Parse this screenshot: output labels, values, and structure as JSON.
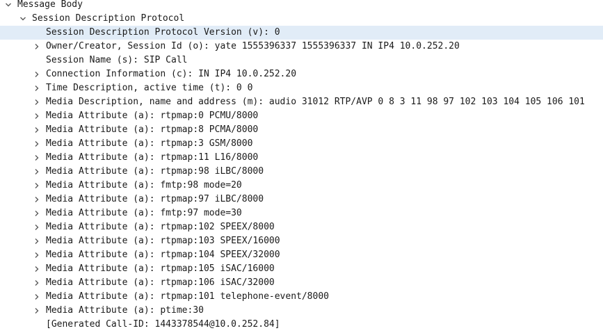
{
  "tree": {
    "message_body": {
      "label": "Message Body",
      "state": "expanded"
    },
    "sdp": {
      "label": "Session Description Protocol",
      "state": "expanded"
    },
    "fields": [
      {
        "label": "Session Description Protocol Version (v): 0",
        "expandable": false,
        "selected": true
      },
      {
        "label": "Owner/Creator, Session Id (o): yate 1555396337 1555396337 IN IP4 10.0.252.20",
        "expandable": true
      },
      {
        "label": "Session Name (s): SIP Call",
        "expandable": false
      },
      {
        "label": "Connection Information (c): IN IP4 10.0.252.20",
        "expandable": true
      },
      {
        "label": "Time Description, active time (t): 0 0",
        "expandable": true
      },
      {
        "label": "Media Description, name and address (m): audio 31012 RTP/AVP 0 8 3 11 98 97 102 103 104 105 106 101",
        "expandable": true
      },
      {
        "label": "Media Attribute (a): rtpmap:0 PCMU/8000",
        "expandable": true
      },
      {
        "label": "Media Attribute (a): rtpmap:8 PCMA/8000",
        "expandable": true
      },
      {
        "label": "Media Attribute (a): rtpmap:3 GSM/8000",
        "expandable": true
      },
      {
        "label": "Media Attribute (a): rtpmap:11 L16/8000",
        "expandable": true
      },
      {
        "label": "Media Attribute (a): rtpmap:98 iLBC/8000",
        "expandable": true
      },
      {
        "label": "Media Attribute (a): fmtp:98 mode=20",
        "expandable": true
      },
      {
        "label": "Media Attribute (a): rtpmap:97 iLBC/8000",
        "expandable": true
      },
      {
        "label": "Media Attribute (a): fmtp:97 mode=30",
        "expandable": true
      },
      {
        "label": "Media Attribute (a): rtpmap:102 SPEEX/8000",
        "expandable": true
      },
      {
        "label": "Media Attribute (a): rtpmap:103 SPEEX/16000",
        "expandable": true
      },
      {
        "label": "Media Attribute (a): rtpmap:104 SPEEX/32000",
        "expandable": true
      },
      {
        "label": "Media Attribute (a): rtpmap:105 iSAC/16000",
        "expandable": true
      },
      {
        "label": "Media Attribute (a): rtpmap:106 iSAC/32000",
        "expandable": true
      },
      {
        "label": "Media Attribute (a): rtpmap:101 telephone-event/8000",
        "expandable": true
      },
      {
        "label": "Media Attribute (a): ptime:30",
        "expandable": true
      },
      {
        "label": "[Generated Call-ID: 1443378544@10.0.252.84]",
        "expandable": false
      }
    ]
  },
  "icons": {
    "expanded": "chevron-down-icon",
    "collapsed": "chevron-right-icon"
  },
  "colors": {
    "text": "#1a1a1a",
    "chevron": "#5a5a5a",
    "selected_background": "#e1ecf7",
    "background": "#ffffff"
  }
}
